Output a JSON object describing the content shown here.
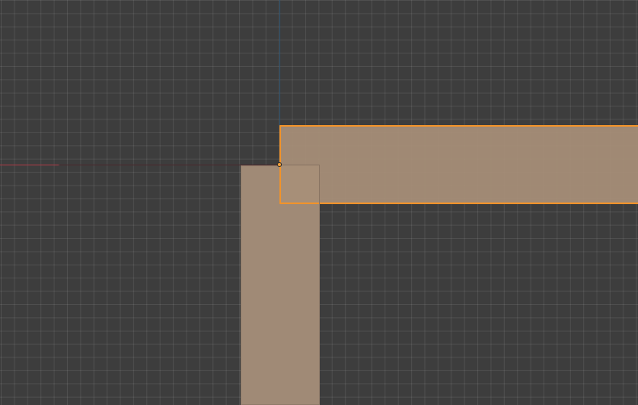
{
  "viewport": {
    "mode": "2D viewport",
    "background_color": "#3d3d3d",
    "grid_color": "#4b4b4b"
  },
  "axes": {
    "x_axis_color": "#a33a45",
    "y_axis_color": "#2b4f6b"
  },
  "objects": [
    {
      "name": "vertical-block",
      "selected": false,
      "fill_color": "#a08a76"
    },
    {
      "name": "horizontal-block",
      "selected": true,
      "fill_color": "#a88f79",
      "outline_color": "#f0932b"
    }
  ],
  "origin": {
    "color": "#f2a03c"
  }
}
